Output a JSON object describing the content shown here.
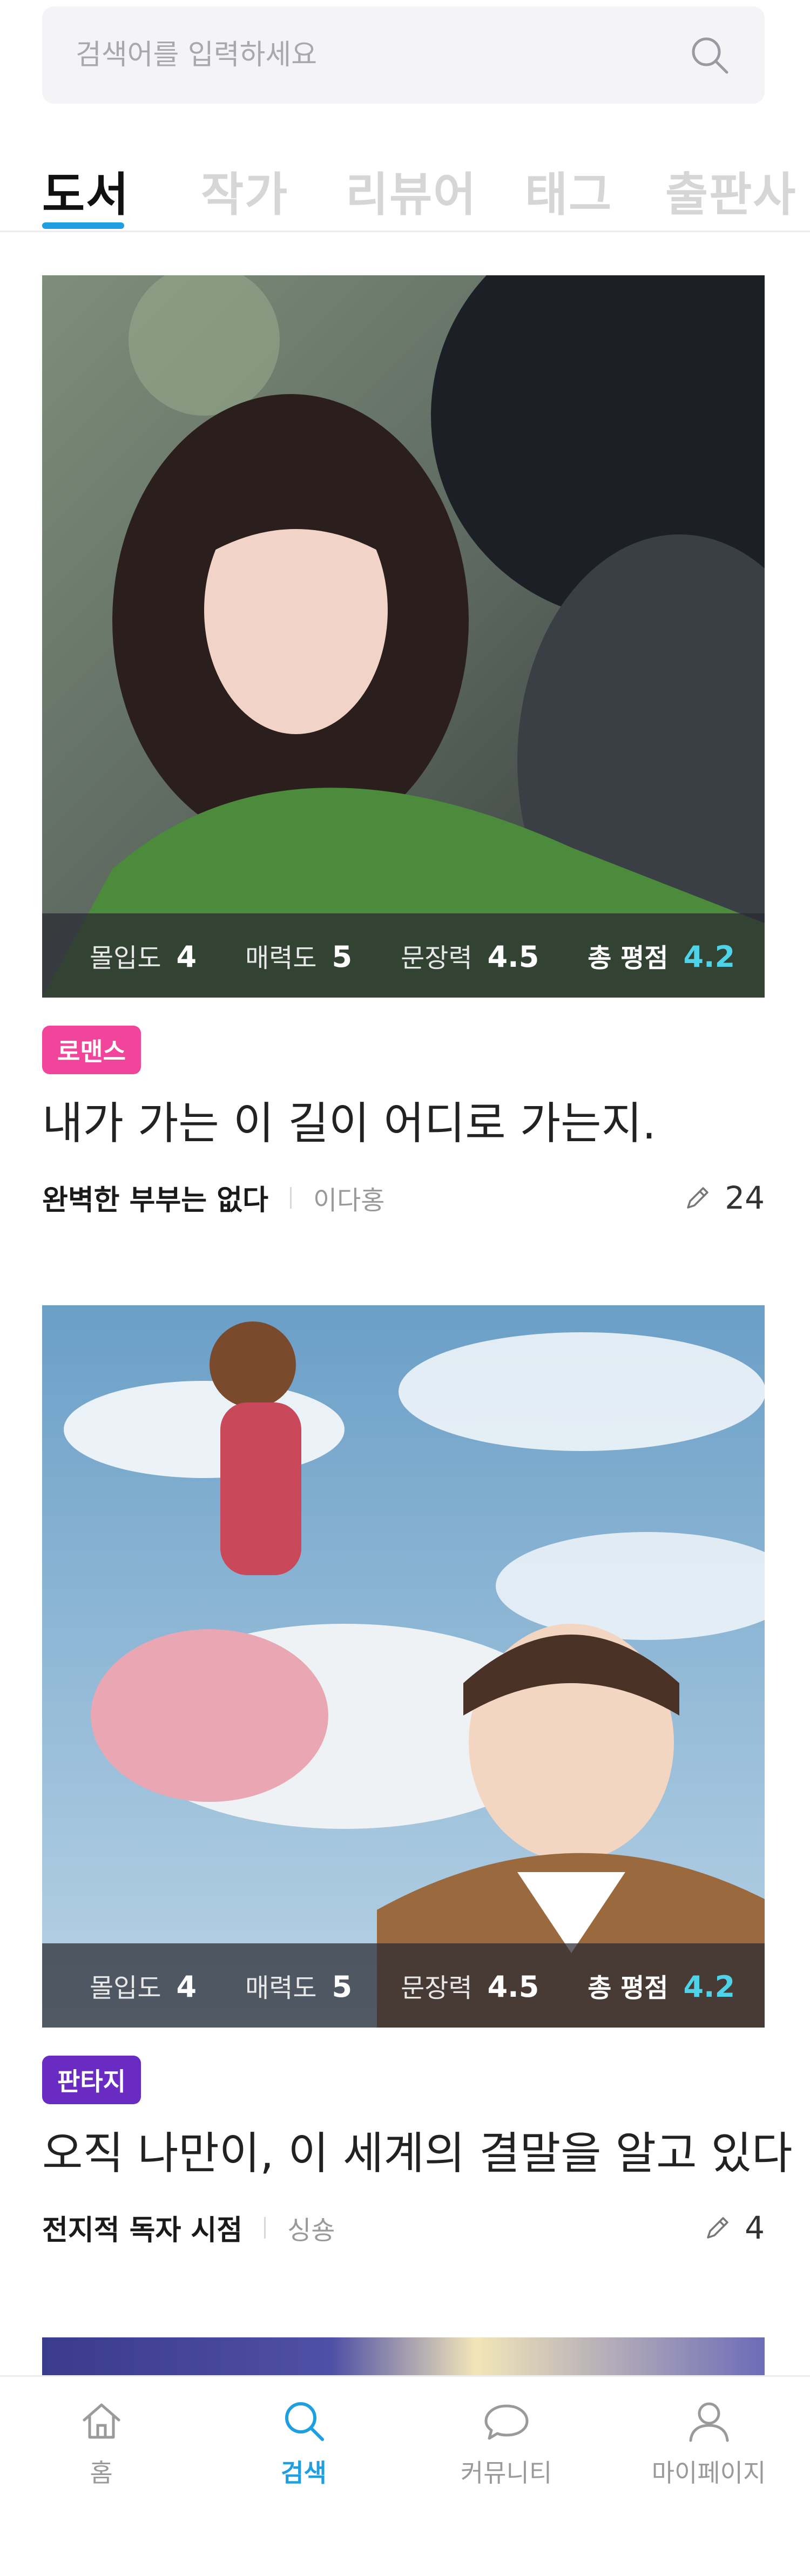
{
  "search": {
    "placeholder": "검색어를 입력하세요",
    "icon": "search-icon"
  },
  "tabs": [
    {
      "label": "도서",
      "active": true
    },
    {
      "label": "작가",
      "active": false
    },
    {
      "label": "리뷰어",
      "active": false
    },
    {
      "label": "태그",
      "active": false
    },
    {
      "label": "출판사",
      "active": false
    }
  ],
  "accent_color": "#1f9ee0",
  "books": [
    {
      "ratings": {
        "immersion_label": "몰입도",
        "immersion": "4",
        "charm_label": "매력도",
        "charm": "5",
        "writing_label": "문장력",
        "writing": "4.5",
        "total_label": "총 평점",
        "total": "4.2"
      },
      "genre": "로맨스",
      "genre_color": "#f0459a",
      "title": "내가 가는 이 길이 어디로 가는지.",
      "work": "완벽한 부부는 없다",
      "author": "이다홍",
      "review_count": "24"
    },
    {
      "ratings": {
        "immersion_label": "몰입도",
        "immersion": "4",
        "charm_label": "매력도",
        "charm": "5",
        "writing_label": "문장력",
        "writing": "4.5",
        "total_label": "총 평점",
        "total": "4.2"
      },
      "genre": "판타지",
      "genre_color": "#6a2bc2",
      "title": "오직 나만이, 이 세계의 결말을 알고 있다",
      "work": "전지적 독자 시점",
      "author": "싱숑",
      "review_count": "4"
    }
  ],
  "nav": [
    {
      "label": "홈",
      "icon": "home-icon",
      "active": false
    },
    {
      "label": "검색",
      "icon": "search-icon",
      "active": true
    },
    {
      "label": "커뮤니티",
      "icon": "chat-bubble-icon",
      "active": false
    },
    {
      "label": "마이페이지",
      "icon": "user-icon",
      "active": false
    }
  ]
}
